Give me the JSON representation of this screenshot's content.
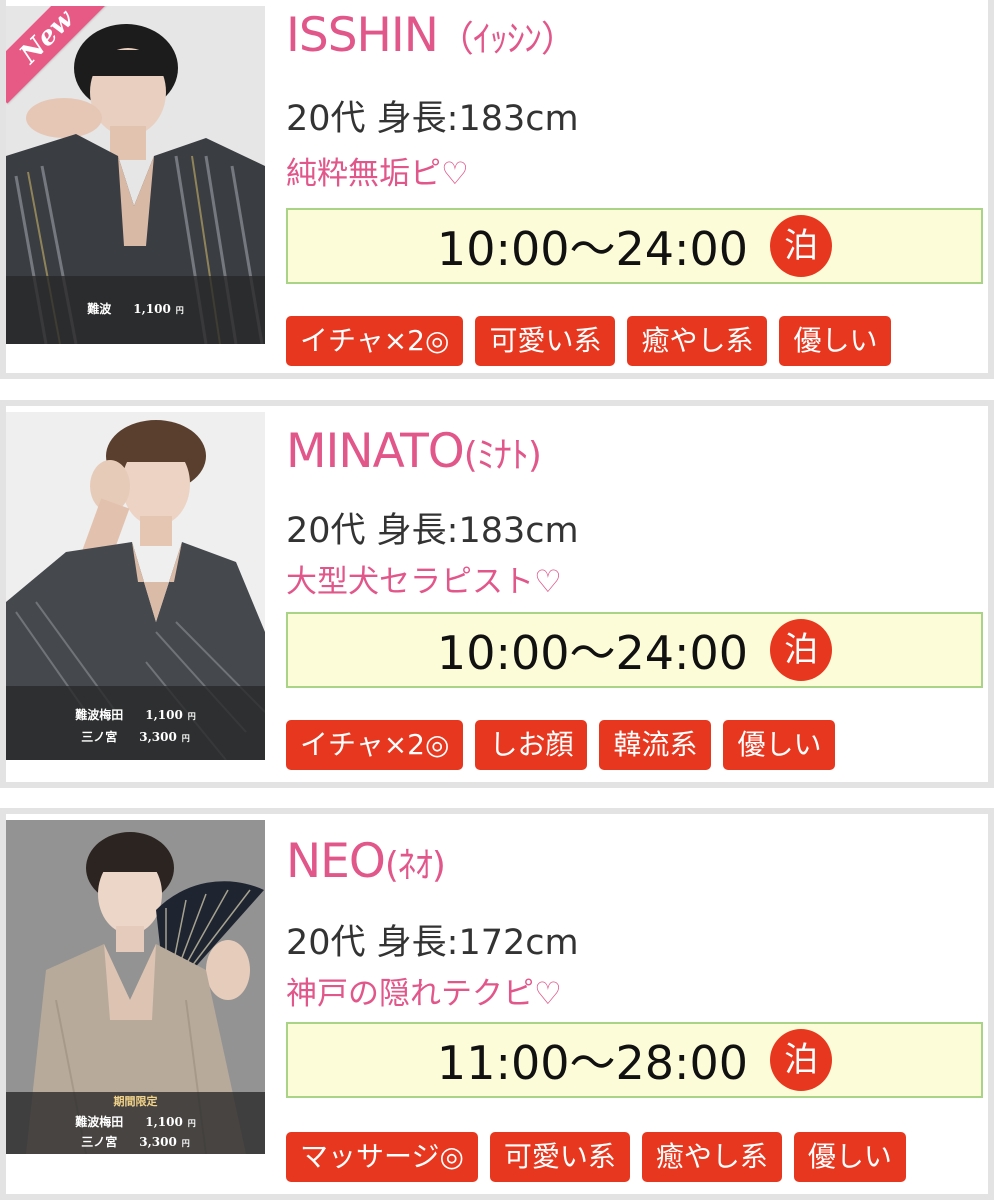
{
  "cast": [
    {
      "name": "ISSHIN",
      "kana": "（ｲｯｼﾝ）",
      "meta": "20代 身長:183cm",
      "catch": "純粋無垢ピ♡",
      "time": "10:00〜24:00",
      "stay": "泊",
      "new": "New",
      "prices": [
        {
          "area": "難波",
          "amount": "1,100",
          "yen": "円"
        }
      ],
      "tags": [
        "イチャ×2◎",
        "可愛い系",
        "癒やし系",
        "優しい"
      ]
    },
    {
      "name": "MINATO",
      "kana": "(ﾐﾅﾄ)",
      "meta": "20代 身長:183cm",
      "catch": "大型犬セラピスト♡",
      "time": "10:00〜24:00",
      "stay": "泊",
      "prices": [
        {
          "area": "難波梅田",
          "amount": "1,100",
          "yen": "円"
        },
        {
          "area": "三ノ宮",
          "amount": "3,300",
          "yen": "円"
        }
      ],
      "tags": [
        "イチャ×2◎",
        "しお顔",
        "韓流系",
        "優しい"
      ]
    },
    {
      "name": "NEO",
      "kana": "(ﾈｵ)",
      "meta": "20代 身長:172cm",
      "catch": "神戸の隠れテクピ♡",
      "time": "11:00〜28:00",
      "stay": "泊",
      "price_title": "期間限定",
      "prices": [
        {
          "area": "難波梅田",
          "amount": "1,100",
          "yen": "円"
        },
        {
          "area": "三ノ宮",
          "amount": "3,300",
          "yen": "円"
        }
      ],
      "tags": [
        "マッサージ◎",
        "可愛い系",
        "癒やし系",
        "優しい"
      ]
    }
  ]
}
